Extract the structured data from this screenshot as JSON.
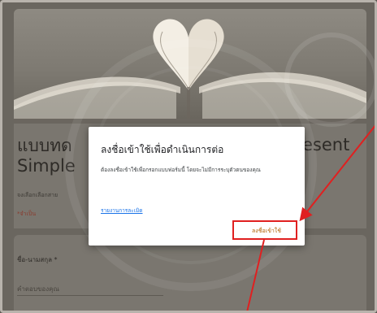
{
  "form": {
    "title_left": "แบบทด",
    "title_line2": "Simple",
    "title_right": "esent",
    "description": "จงเลือกเลือกสาย",
    "required_note": "*จำเป็น",
    "question": {
      "label": "ชื่อ-นามสกุล *",
      "answer_placeholder": "คำตอบของคุณ"
    }
  },
  "modal": {
    "title": "ลงชื่อเข้าใช้เพื่อดำเนินการต่อ",
    "body": "ต้องลงชื่อเข้าใช้เพื่อกรอกแบบฟอร์มนี้ โดยจะไม่มีการระบุตัวตนของคุณ",
    "link": "รายงานการละเมิด",
    "signin_button": "ลงชื่อเข้าใช้"
  },
  "colors": {
    "annotation_red": "#e02020",
    "button_text": "#b06000",
    "link": "#1a73e8"
  }
}
